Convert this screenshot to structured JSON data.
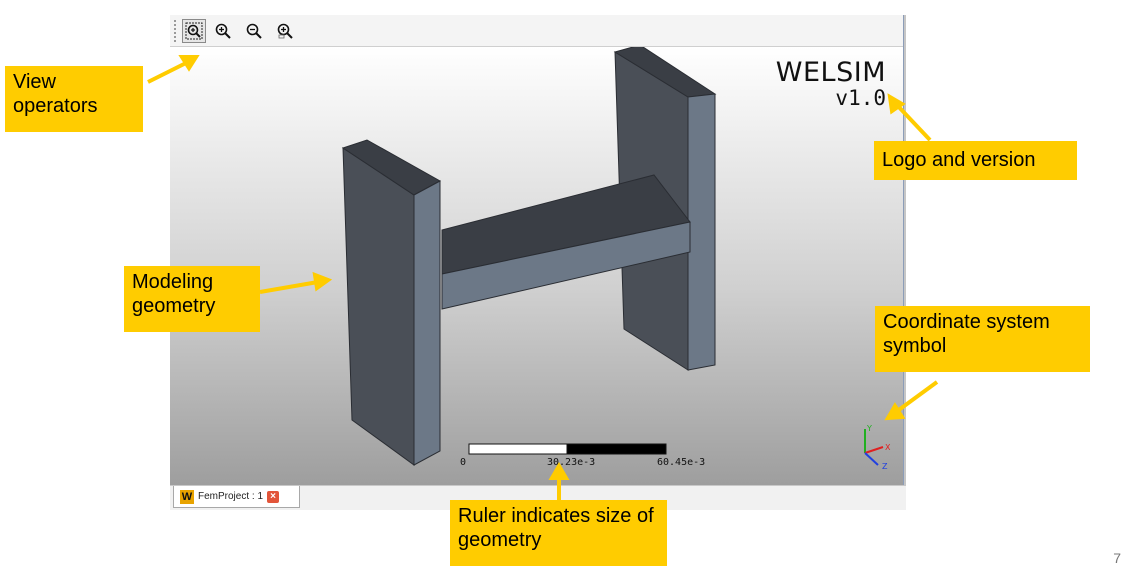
{
  "toolbar": {
    "buttons": [
      {
        "name": "zoom-box-icon",
        "active": true
      },
      {
        "name": "zoom-in-icon",
        "active": false
      },
      {
        "name": "zoom-out-icon",
        "active": false
      },
      {
        "name": "zoom-fit-icon",
        "active": false
      }
    ]
  },
  "logo": {
    "name": "WELSIM",
    "version": "v1.0"
  },
  "ruler": {
    "labels": [
      "0",
      "30.23e-3",
      "60.45e-3"
    ]
  },
  "axes": {
    "x": "X",
    "y": "Y",
    "z": "Z",
    "colors": {
      "x": "#e02020",
      "y": "#20b020",
      "z": "#2040e0"
    }
  },
  "tab": {
    "icon_letter": "W",
    "label": "FemProject : 1",
    "close": "×"
  },
  "callouts": {
    "view_operators": "View operators",
    "logo_version": "Logo and version",
    "modeling_geometry": "Modeling geometry",
    "coordinate_system": "Coordinate system symbol",
    "ruler": "Ruler indicates size of geometry"
  },
  "page_number": "7",
  "colors": {
    "callout": "#ffcc00",
    "geometry_front": "#4a4f57",
    "geometry_side": "#6c7887",
    "geometry_top": "#3a3e45"
  }
}
